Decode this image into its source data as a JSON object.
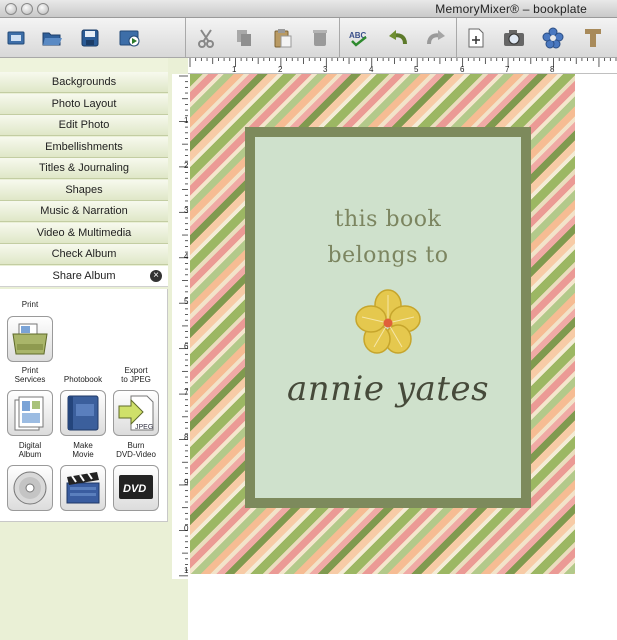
{
  "window": {
    "title": "MemoryMixer® – bookplate"
  },
  "toolbar": {
    "buttons": [
      {
        "name": "new-window-icon"
      },
      {
        "name": "open-folder-icon"
      },
      {
        "name": "save-disk-icon"
      },
      {
        "name": "slideshow-icon"
      },
      {
        "name": "cut-scissors-icon"
      },
      {
        "name": "copy-icon"
      },
      {
        "name": "paste-icon"
      },
      {
        "name": "delete-icon"
      },
      {
        "name": "spellcheck-icon"
      },
      {
        "name": "undo-icon"
      },
      {
        "name": "redo-icon"
      },
      {
        "name": "new-page-icon"
      },
      {
        "name": "camera-icon"
      },
      {
        "name": "flower-icon"
      },
      {
        "name": "text-tool-icon"
      }
    ]
  },
  "sidebar": {
    "items": [
      {
        "label": "Backgrounds"
      },
      {
        "label": "Photo Layout"
      },
      {
        "label": "Edit Photo"
      },
      {
        "label": "Embellishments"
      },
      {
        "label": "Titles & Journaling"
      },
      {
        "label": "Shapes"
      },
      {
        "label": "Music & Narration"
      },
      {
        "label": "Video & Multimedia"
      },
      {
        "label": "Check Album"
      },
      {
        "label": "Share Album"
      }
    ],
    "share_tools": {
      "print": "Print",
      "print_services_1": "Print",
      "print_services_2": "Services",
      "photobook": "Photobook",
      "export_1": "Export",
      "export_2": "to JPEG",
      "digital_1": "Digital",
      "digital_2": "Album",
      "movie_1": "Make",
      "movie_2": "Movie",
      "burn_1": "Burn",
      "burn_2": "DVD-Video",
      "jpeg_icon_text": "JPEG",
      "dvd_icon_text": "DVD"
    }
  },
  "rulers": {
    "top": [
      "1",
      "2",
      "3",
      "4",
      "5",
      "6",
      "7",
      "8"
    ],
    "left": [
      "1",
      "2",
      "3",
      "4",
      "5",
      "6",
      "7",
      "8",
      "9",
      "0",
      "1"
    ]
  },
  "bookplate": {
    "line1": "this book",
    "line2": "belongs to",
    "name": "annie yates"
  }
}
